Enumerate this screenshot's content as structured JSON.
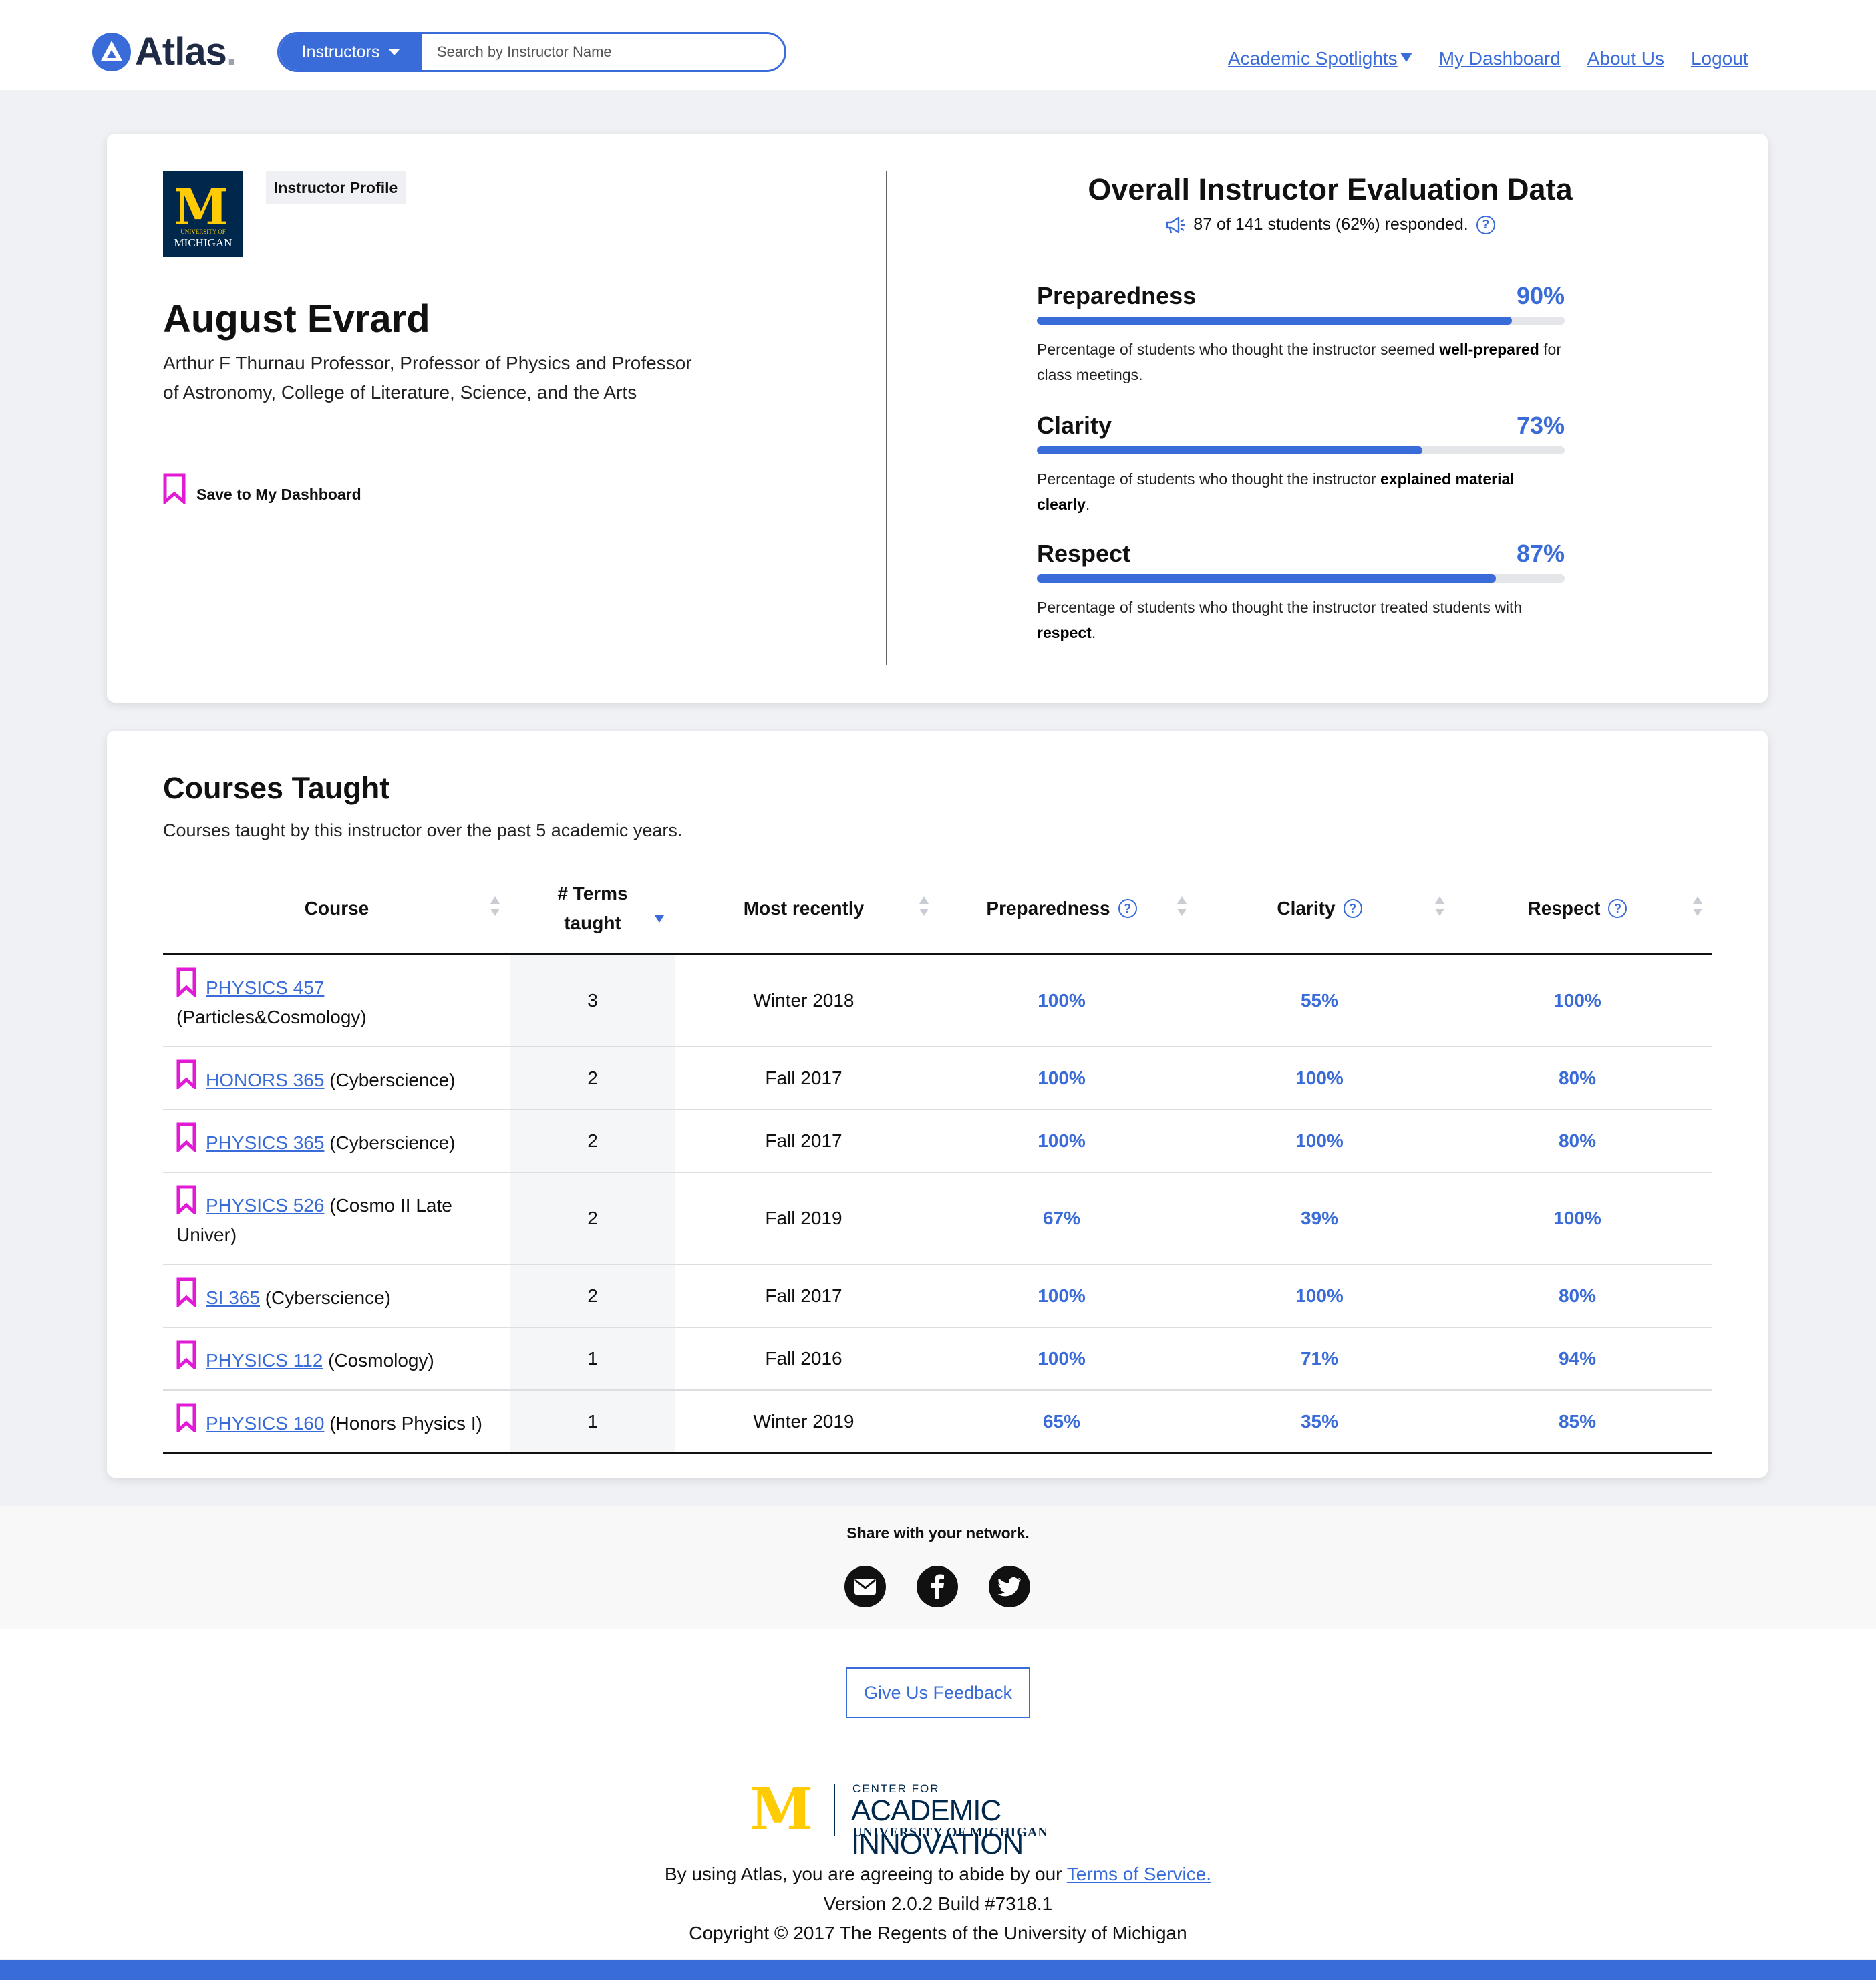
{
  "header": {
    "logo_text": "Atlas",
    "logo_dot": ".",
    "search_select_label": "Instructors",
    "search_placeholder": "Search by Instructor Name",
    "nav": {
      "spotlights": "Academic Spotlights",
      "dashboard": "My Dashboard",
      "about": "About Us",
      "logout": "Logout"
    }
  },
  "profile": {
    "logo_m": "M",
    "logo_line1": "UNIVERSITY OF",
    "logo_line2": "MICHIGAN",
    "badge": "Instructor Profile",
    "name": "August Evrard",
    "title": "Arthur F Thurnau Professor, Professor of Physics and Professor of Astronomy, College of Literature, Science, and the Arts",
    "save_label": "Save to My Dashboard"
  },
  "evaluation": {
    "title": "Overall Instructor Evaluation Data",
    "responded": "87 of 141 students (62%) responded.",
    "metrics": [
      {
        "name": "Preparedness",
        "value_label": "90%",
        "value": 90,
        "desc_pre": "Percentage of students who thought the instructor seemed ",
        "desc_bold": "well-prepared",
        "desc_post": " for class meetings."
      },
      {
        "name": "Clarity",
        "value_label": "73%",
        "value": 73,
        "desc_pre": "Percentage of students who thought the instructor ",
        "desc_bold": "explained material clearly",
        "desc_post": "."
      },
      {
        "name": "Respect",
        "value_label": "87%",
        "value": 87,
        "desc_pre": "Percentage of students who thought the instructor treated students with ",
        "desc_bold": "respect",
        "desc_post": "."
      }
    ]
  },
  "courses": {
    "title": "Courses Taught",
    "subtitle": "Courses taught by this instructor over the past 5 academic years.",
    "columns": {
      "course": "Course",
      "terms_line1": "# Terms",
      "terms_line2": "taught",
      "recent": "Most recently",
      "preparedness": "Preparedness",
      "clarity": "Clarity",
      "respect": "Respect"
    },
    "rows": [
      {
        "code": "PHYSICS 457",
        "name": "(Particles&Cosmology)",
        "terms": "3",
        "recent": "Winter 2018",
        "prep": "100%",
        "clarity": "55%",
        "respect": "100%"
      },
      {
        "code": "HONORS 365",
        "name": "(Cyberscience)",
        "terms": "2",
        "recent": "Fall 2017",
        "prep": "100%",
        "clarity": "100%",
        "respect": "80%"
      },
      {
        "code": "PHYSICS 365",
        "name": "(Cyberscience)",
        "terms": "2",
        "recent": "Fall 2017",
        "prep": "100%",
        "clarity": "100%",
        "respect": "80%"
      },
      {
        "code": "PHYSICS 526",
        "name": "(Cosmo II Late Univer)",
        "terms": "2",
        "recent": "Fall 2019",
        "prep": "67%",
        "clarity": "39%",
        "respect": "100%"
      },
      {
        "code": "SI 365",
        "name": "(Cyberscience)",
        "terms": "2",
        "recent": "Fall 2017",
        "prep": "100%",
        "clarity": "100%",
        "respect": "80%"
      },
      {
        "code": "PHYSICS 112",
        "name": "(Cosmology)",
        "terms": "1",
        "recent": "Fall 2016",
        "prep": "100%",
        "clarity": "71%",
        "respect": "94%"
      },
      {
        "code": "PHYSICS 160",
        "name": "(Honors Physics I)",
        "terms": "1",
        "recent": "Winter 2019",
        "prep": "65%",
        "clarity": "35%",
        "respect": "85%"
      }
    ]
  },
  "share": {
    "title": "Share with your network.",
    "icons": [
      "email-icon",
      "facebook-icon",
      "twitter-icon"
    ]
  },
  "footer": {
    "feedback": "Give Us Feedback",
    "cai_m": "M",
    "cai_line1": "CENTER FOR",
    "cai_line2": "ACADEMIC INNOVATION",
    "cai_line3": "UNIVERSITY OF MICHIGAN",
    "terms_pre": "By using Atlas, you are agreeing to abide by our ",
    "terms_link": "Terms of Service.",
    "version": "Version 2.0.2 Build #7318.1",
    "copyright": "Copyright © 2017 The Regents of the University of Michigan"
  },
  "colors": {
    "accent": "#3a6cd9",
    "bookmark": "#e21ad6",
    "michigan_blue": "#00274c",
    "maize": "#ffcb05"
  }
}
